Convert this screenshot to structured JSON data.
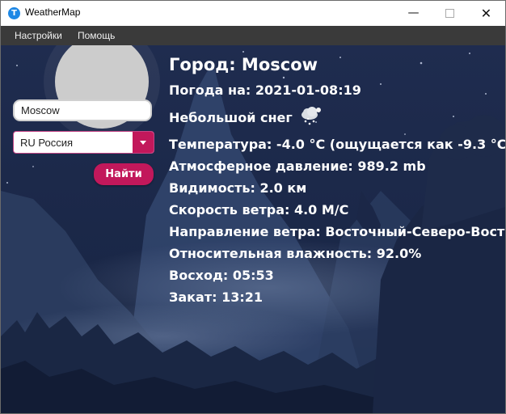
{
  "window": {
    "title": "WeatherMap",
    "app_icon_letter": "T"
  },
  "menu": [
    "Настройки",
    "Помощь"
  ],
  "search": {
    "city_value": "Moscow",
    "country_value": "RU Россия",
    "button_label": "Найти"
  },
  "weather": {
    "city": "Город: Moscow",
    "date": "Погода на: 2021-01-08:19",
    "description": "Небольшой снег",
    "icon": "light-snow-icon",
    "temperature": "Температура: -4.0 °C (ощущается как -9.3 °C)",
    "pressure": "Атмосферное давление: 989.2 mb",
    "visibility": "Видимость: 2.0 км",
    "wind_speed": "Скорость ветра: 4.0 М/С",
    "wind_direction": "Направление ветра: Восточный-Северо-Вост…",
    "humidity": "Относительная влажность: 92.0%",
    "sunrise": "Восход: 05:53",
    "sunset": "Закат: 13:21"
  },
  "colors": {
    "accent": "#c2185b",
    "menubar": "#3a3a3a",
    "sky_top": "#1f2c4f",
    "sky_bottom": "#0e1830"
  }
}
